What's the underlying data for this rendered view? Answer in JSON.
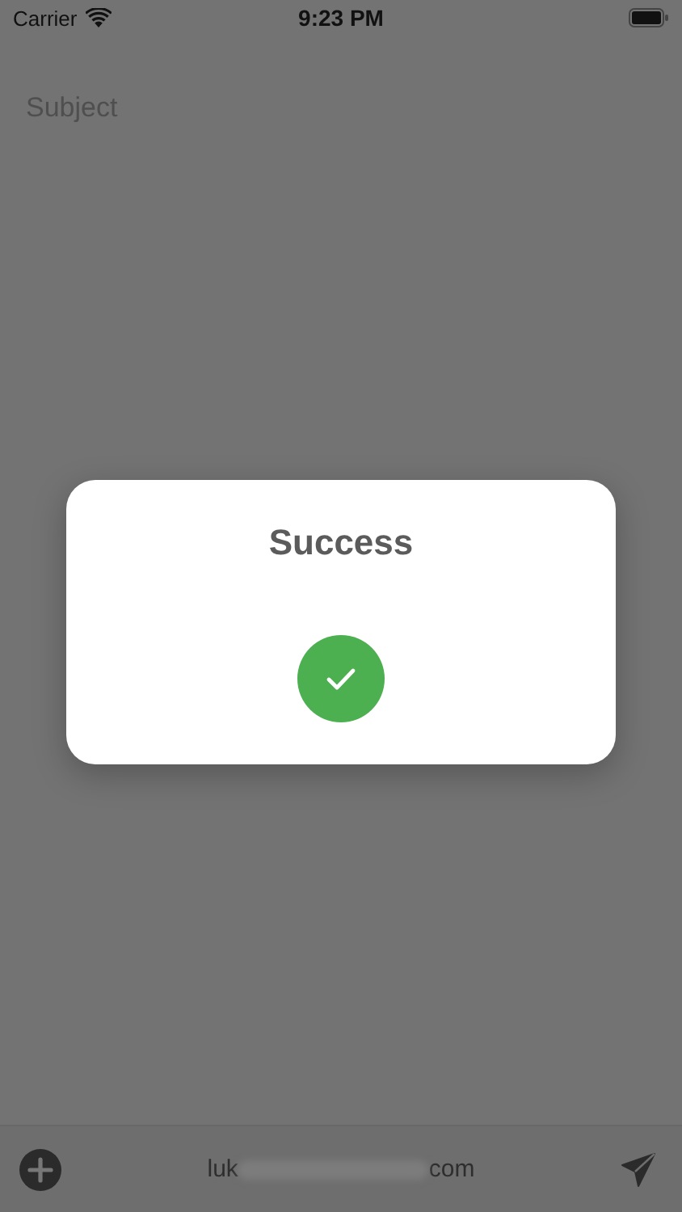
{
  "status_bar": {
    "carrier": "Carrier",
    "time": "9:23 PM"
  },
  "subject": {
    "placeholder": "Subject"
  },
  "dialog": {
    "title": "Success",
    "succeeded": true
  },
  "bottom_bar": {
    "recipient_start": "luk",
    "recipient_end": "com"
  }
}
